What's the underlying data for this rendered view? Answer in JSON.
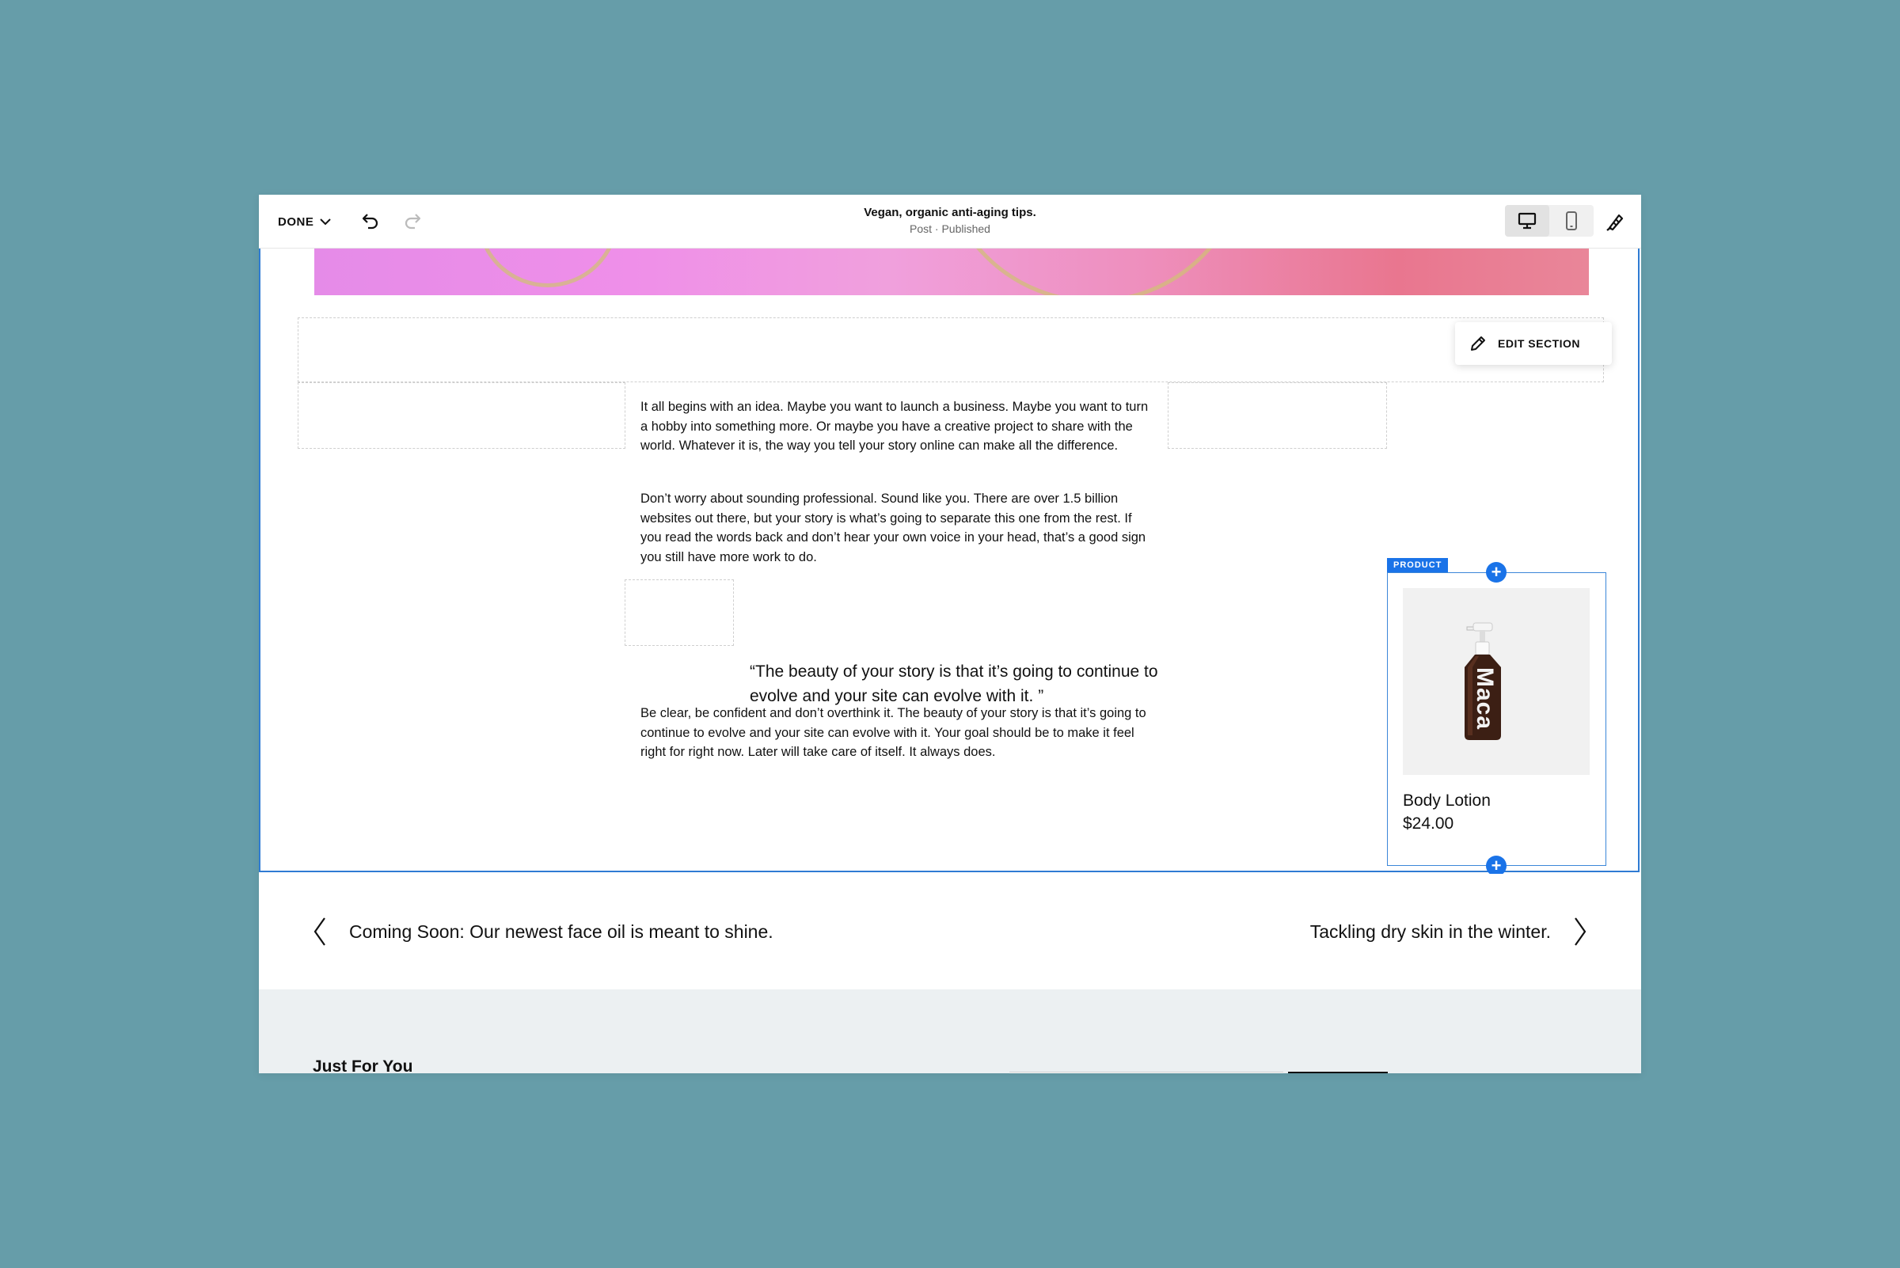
{
  "toolbar": {
    "done_label": "DONE",
    "title": "Vegan, organic anti-aging tips.",
    "subtitle": "Post · Published"
  },
  "edit_section_label": "EDIT SECTION",
  "article": {
    "paragraphs": [
      "It all begins with an idea. Maybe you want to launch a business. Maybe you want to turn a hobby into something more. Or maybe you have a creative project to share with the world. Whatever it is, the way you tell your story online can make all the difference.",
      "Don’t worry about sounding professional. Sound like you. There are over 1.5 billion websites out there, but your story is what’s going to separate this one from the rest. If you read the words back and don’t hear your own voice in your head, that’s a good sign you still have more work to do."
    ],
    "quote": "“The beauty of your story is that it’s going to continue to evolve and your site can evolve with it. ”",
    "closing": "Be clear, be confident and don’t overthink it. The beauty of your story is that it’s going to continue to evolve and your site can evolve with it. Your goal should be to make it feel right for right now. Later will take care of itself. It always does."
  },
  "product": {
    "tag": "PRODUCT",
    "bottle_text": "Maca",
    "name": "Body Lotion",
    "price": "$24.00"
  },
  "pagination": {
    "prev": "Coming Soon: Our newest face oil is meant to shine.",
    "next": "Tackling dry skin in the winter."
  },
  "footer": {
    "heading": "Just For You"
  },
  "icons": [
    "chevron-down-icon",
    "undo-icon",
    "redo-icon",
    "desktop-icon",
    "mobile-icon",
    "paintbrush-icon",
    "pencil-icon",
    "add-icon",
    "chevron-left-icon",
    "chevron-right-icon"
  ],
  "colors": {
    "background": "#669da9",
    "accent": "#1a73e8",
    "section_border": "#2f7bd3",
    "footer_bg": "#ecf0f2"
  }
}
